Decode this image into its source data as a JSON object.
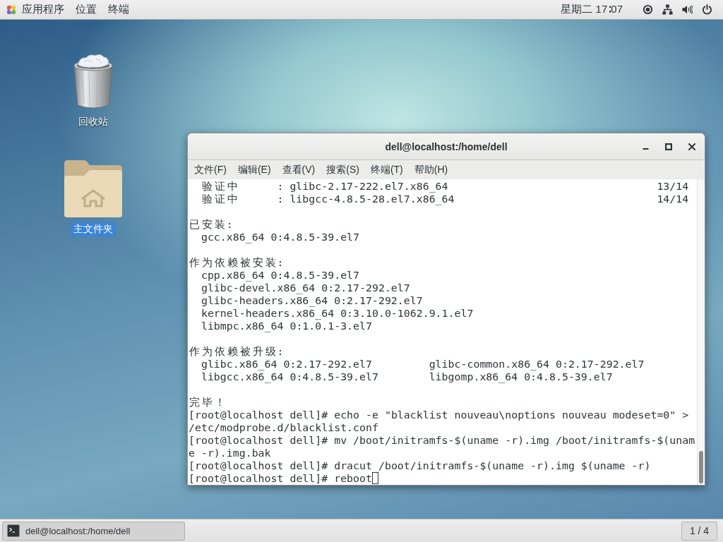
{
  "top_bar": {
    "applications_menu": "应用程序",
    "places_menu": "位置",
    "app_menu": "终端",
    "clock": "星期二 17∶07"
  },
  "desktop_icons": [
    {
      "kind": "trash",
      "label": "回收站",
      "selected": false
    },
    {
      "kind": "home_folder",
      "label": "主文件夹",
      "selected": true
    }
  ],
  "terminal_window": {
    "title": "dell@localhost:/home/dell",
    "menu": [
      "文件(F)",
      "编辑(E)",
      "查看(V)",
      "搜索(S)",
      "终端(T)",
      "帮助(H)"
    ],
    "lines": [
      {
        "kind": "indented",
        "text": "验证中      : glibc-2.17-222.el7.x86_64",
        "progress": "13/14"
      },
      {
        "kind": "indented",
        "text": "验证中      : libgcc-4.8.5-28.el7.x86_64",
        "progress": "14/14"
      },
      {
        "kind": "blank"
      },
      {
        "kind": "text",
        "text": "已安装:"
      },
      {
        "kind": "indented",
        "text": "gcc.x86_64 0:4.8.5-39.el7"
      },
      {
        "kind": "blank"
      },
      {
        "kind": "text",
        "text": "作为依赖被安装:"
      },
      {
        "kind": "indented",
        "text": "cpp.x86_64 0:4.8.5-39.el7"
      },
      {
        "kind": "indented",
        "text": "glibc-devel.x86_64 0:2.17-292.el7"
      },
      {
        "kind": "indented",
        "text": "glibc-headers.x86_64 0:2.17-292.el7"
      },
      {
        "kind": "indented",
        "text": "kernel-headers.x86_64 0:3.10.0-1062.9.1.el7"
      },
      {
        "kind": "indented",
        "text": "libmpc.x86_64 0:1.0.1-3.el7"
      },
      {
        "kind": "blank"
      },
      {
        "kind": "text",
        "text": "作为依赖被升级:"
      },
      {
        "kind": "columns",
        "columns": [
          "glibc.x86_64 0:2.17-292.el7",
          "glibc-common.x86_64 0:2.17-292.el7"
        ]
      },
      {
        "kind": "columns",
        "columns": [
          "libgcc.x86_64 0:4.8.5-39.el7",
          "libgomp.x86_64 0:4.8.5-39.el7"
        ]
      },
      {
        "kind": "blank"
      },
      {
        "kind": "text",
        "text": "完毕！"
      },
      {
        "kind": "text",
        "text": "[root@localhost dell]# echo -e \"blacklist nouveau\\noptions nouveau modeset=0\" >"
      },
      {
        "kind": "text",
        "text": "/etc/modprobe.d/blacklist.conf"
      },
      {
        "kind": "text",
        "text": "[root@localhost dell]# mv /boot/initramfs-$(uname -r).img /boot/initramfs-$(unam"
      },
      {
        "kind": "text",
        "text": "e -r).img.bak"
      },
      {
        "kind": "text",
        "text": "[root@localhost dell]# dracut /boot/initramfs-$(uname -r).img $(uname -r)"
      },
      {
        "kind": "text",
        "text": "[root@localhost dell]# reboot"
      }
    ],
    "cursor_visible": true
  },
  "taskbar": {
    "tasks": [
      {
        "label": "dell@localhost:/home/dell",
        "selected": true
      }
    ],
    "workspace": "1 / 4"
  }
}
